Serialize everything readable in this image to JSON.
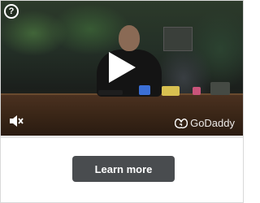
{
  "icons": {
    "help": "question-circle-icon",
    "play": "play-icon",
    "mute": "muted-speaker-icon",
    "brand_logo": "godaddy-logo-icon"
  },
  "help_glyph": "?",
  "brand_name": "GoDaddy",
  "progress": 0.0,
  "cta": {
    "label": "Learn more"
  },
  "colors": {
    "cta_background": "#494c4f",
    "cta_text": "#ffffff",
    "overlay_text": "#ffffff"
  }
}
